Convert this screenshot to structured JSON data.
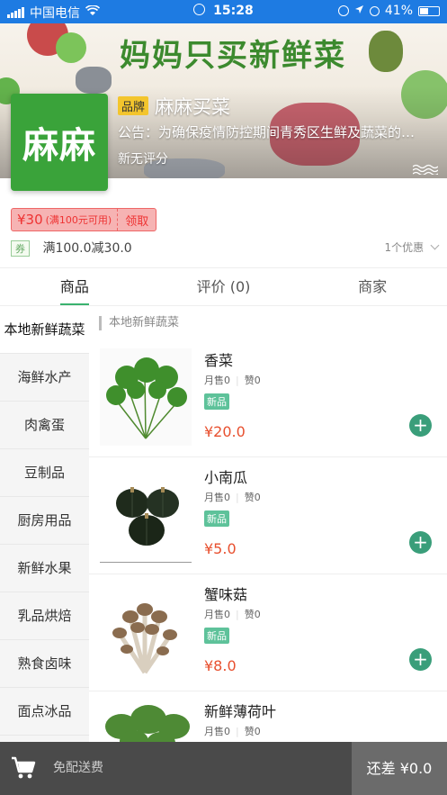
{
  "status_bar": {
    "carrier": "中国电信",
    "time": "15:28",
    "battery": "41%"
  },
  "banner": {
    "slogan": "妈妈只买新鲜菜"
  },
  "store": {
    "logo_text": "麻麻",
    "brand_tag": "品牌",
    "name": "麻麻买菜",
    "notice": "公告：为确保疫情防控期间青秀区生鲜及蔬菜的供...",
    "newbie": "新无评分"
  },
  "coupon": {
    "amount": "¥30",
    "condition": "(满100元可用)",
    "get_label": "领取"
  },
  "promo": {
    "tag": "券",
    "text": "满100.0减30.0",
    "count": "1个优惠"
  },
  "tabs": [
    {
      "label": "商品"
    },
    {
      "label": "评价 (0)"
    },
    {
      "label": "商家"
    }
  ],
  "categories": [
    {
      "label": "本地新鲜蔬菜"
    },
    {
      "label": "海鲜水产"
    },
    {
      "label": "肉禽蛋"
    },
    {
      "label": "豆制品"
    },
    {
      "label": "厨房用品"
    },
    {
      "label": "新鲜水果"
    },
    {
      "label": "乳品烘焙"
    },
    {
      "label": "熟食卤味"
    },
    {
      "label": "面点冰品"
    }
  ],
  "section_title": "本地新鲜蔬菜",
  "products": [
    {
      "name": "香菜",
      "sold": "月售0",
      "likes": "赞0",
      "badge": "新品",
      "price": "¥20.0"
    },
    {
      "name": "小南瓜",
      "sold": "月售0",
      "likes": "赞0",
      "badge": "新品",
      "price": "¥5.0"
    },
    {
      "name": "蟹味菇",
      "sold": "月售0",
      "likes": "赞0",
      "badge": "新品",
      "price": "¥8.0"
    },
    {
      "name": "新鲜薄荷叶",
      "sold": "月售0",
      "likes": "赞0",
      "badge": "",
      "price": ""
    }
  ],
  "cart": {
    "shipping": "免配送费",
    "checkout": "还差 ¥0.0"
  },
  "colors": {
    "accent": "#3ab26f",
    "price": "#e8502f",
    "statusbar": "#1e7be2",
    "logo": "#3aa33a"
  }
}
